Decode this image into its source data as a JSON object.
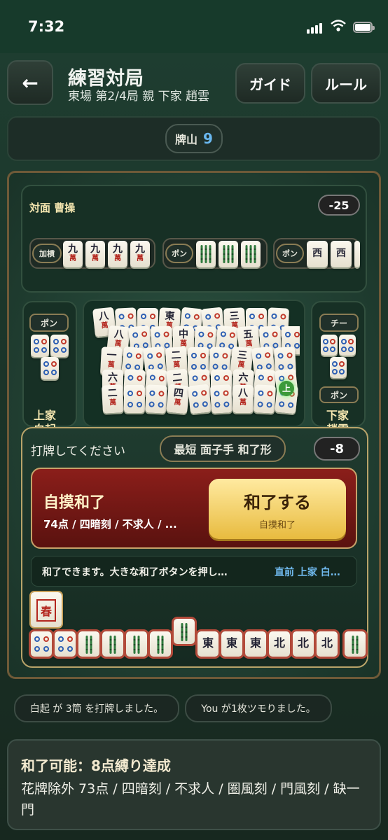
{
  "status": {
    "time": "7:32"
  },
  "header": {
    "back_label": "←",
    "title": "練習対局",
    "subtitle": "東場 第2/4局 親 下家 趙雲",
    "guide": "ガイド",
    "rules": "ルール"
  },
  "wall": {
    "label": "牌山",
    "count": "9"
  },
  "opponent_top": {
    "name": "対面 曹操",
    "score": "-25",
    "melds": [
      {
        "type": "加槓",
        "tiles": [
          "九",
          "九",
          "九",
          "九"
        ],
        "suit": "萬"
      },
      {
        "type": "ポン",
        "tiles": [
          "条",
          "条",
          "条"
        ]
      },
      {
        "type": "ポン",
        "tiles": [
          "西",
          "西",
          "西"
        ]
      }
    ]
  },
  "opponent_left": {
    "meld_type": "ポン",
    "name": "上家",
    "name2": "白起"
  },
  "opponent_right": {
    "meld_type": "チー",
    "meld_type2": "ポン",
    "name": "下家",
    "name2": "趙雲"
  },
  "pond": {
    "marker": "上",
    "visible_tiles": [
      "八",
      "東",
      "三",
      "八",
      "中",
      "五",
      "一",
      "二",
      "三",
      "六",
      "二",
      "六",
      "二",
      "四",
      "八",
      "四",
      "一"
    ]
  },
  "action": {
    "prompt": "打牌してください",
    "hint": "最短 面子手 和了形",
    "score": "-8",
    "win_type": "自摸和了",
    "win_detail": "74点 / 四暗刻 / 不求人 / ...",
    "win_button": "和了する",
    "win_button_sub": "自摸和了",
    "message": "和了できます。大きな和了ボタンを押し…",
    "last": "直前 上家 白…"
  },
  "hand": {
    "flower": "春",
    "tiles": [
      "筒",
      "筒",
      "条",
      "条",
      "条",
      "条",
      "条",
      "東",
      "東",
      "東",
      "北",
      "北",
      "北",
      "条"
    ]
  },
  "log": [
    "白起 が 3筒 を打牌しました。",
    "You が1枚ツモりました。"
  ],
  "result": {
    "title": "和了可能：8点縛り達成",
    "detail": "花牌除外 73点 / 四暗刻 / 不求人 / 圏風刻 / 門風刻 / 缺一門"
  }
}
